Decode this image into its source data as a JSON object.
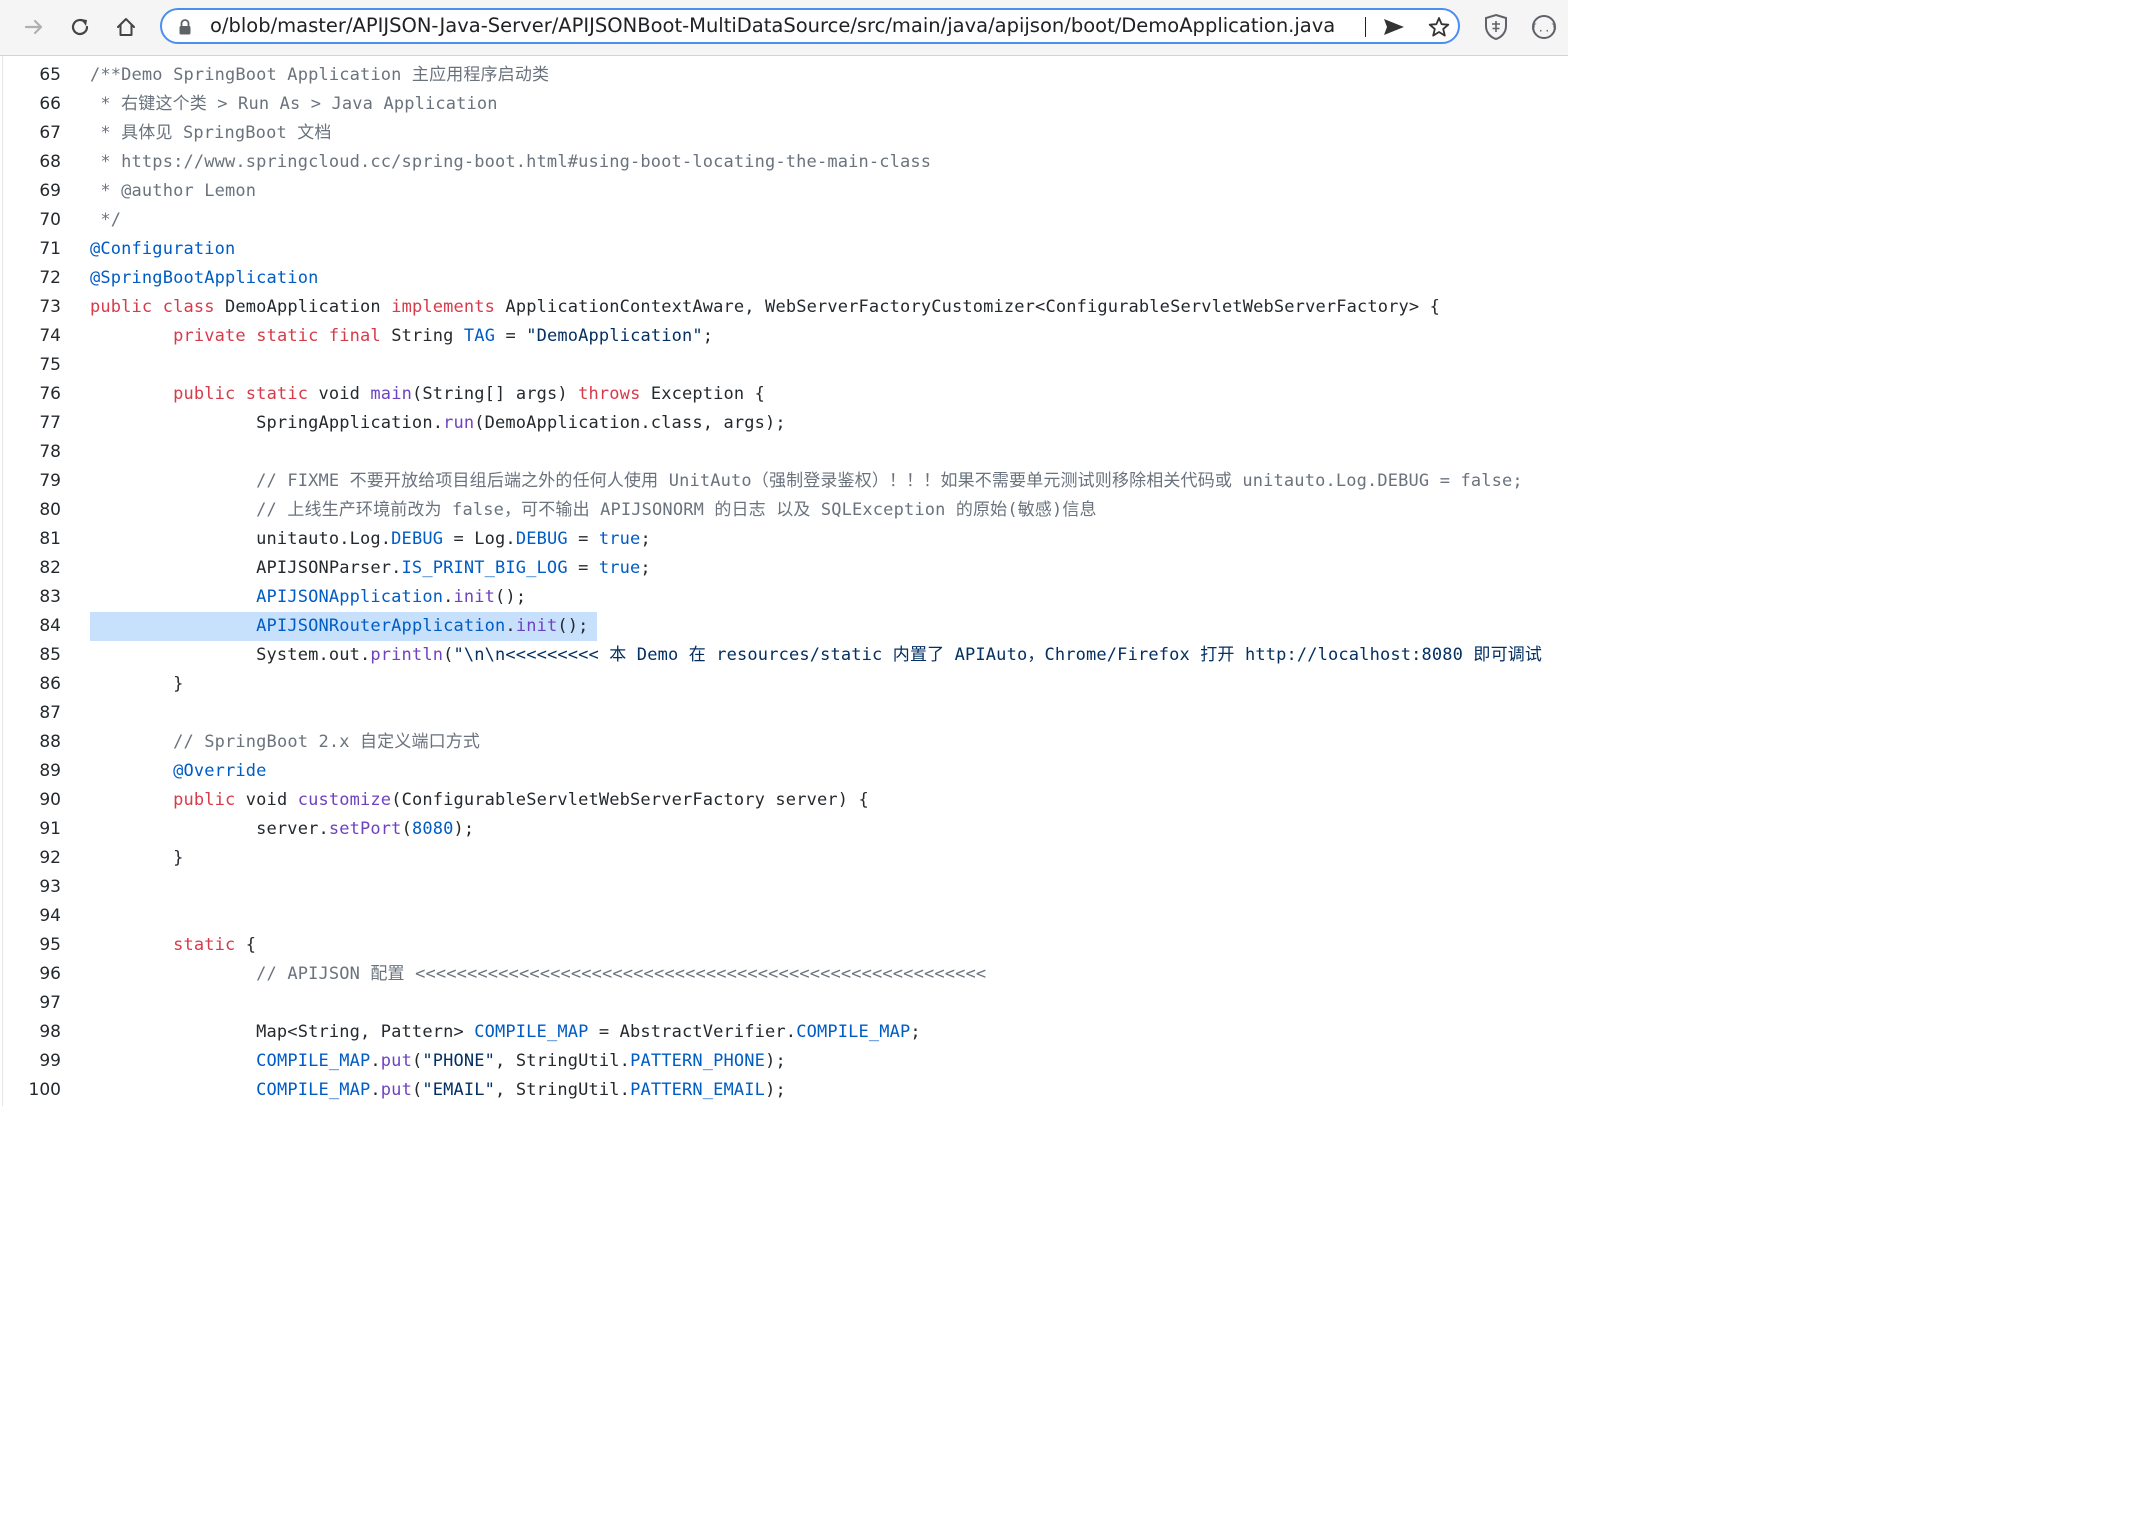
{
  "browser": {
    "url": "o/blob/master/APIJSON-Java-Server/APIJSONBoot-MultiDataSource/src/main/java/apijson/boot/DemoApplication.java",
    "icons": [
      "forward-icon",
      "reload-icon",
      "home-icon",
      "lock-icon",
      "send-icon",
      "star-icon",
      "extension-shield-icon",
      "extension-braces-icon"
    ]
  },
  "colors": {
    "keyword": "#d73a49",
    "function": "#6f42c1",
    "constant": "#005cc5",
    "string": "#032f62",
    "comment": "#6a737d",
    "highlight": "#c7e0fb",
    "omnibox_border": "#4b8ef1"
  },
  "code": {
    "highlighted_line": "84",
    "lines": [
      {
        "n": "65",
        "t": [
          [
            "c",
            "/**Demo SpringBoot Application 主应用程序启动类"
          ]
        ]
      },
      {
        "n": "66",
        "t": [
          [
            "c",
            " * 右键这个类 > Run As > Java Application"
          ]
        ]
      },
      {
        "n": "67",
        "t": [
          [
            "c",
            " * 具体见 SpringBoot 文档"
          ]
        ]
      },
      {
        "n": "68",
        "t": [
          [
            "c",
            " * https://www.springcloud.cc/spring-boot.html#using-boot-locating-the-main-class"
          ]
        ]
      },
      {
        "n": "69",
        "t": [
          [
            "c",
            " * @author Lemon"
          ]
        ]
      },
      {
        "n": "70",
        "t": [
          [
            "c",
            " */"
          ]
        ]
      },
      {
        "n": "71",
        "t": [
          [
            "b",
            "@Configuration"
          ]
        ]
      },
      {
        "n": "72",
        "t": [
          [
            "b",
            "@SpringBootApplication"
          ]
        ]
      },
      {
        "n": "73",
        "t": [
          [
            "k",
            "public"
          ],
          [
            "",
            " "
          ],
          [
            "k",
            "class"
          ],
          [
            "",
            " DemoApplication "
          ],
          [
            "k",
            "implements"
          ],
          [
            "",
            " ApplicationContextAware, WebServerFactoryCustomizer<ConfigurableServletWebServerFactory> {"
          ]
        ]
      },
      {
        "n": "74",
        "t": [
          [
            "",
            "        "
          ],
          [
            "k",
            "private"
          ],
          [
            "",
            " "
          ],
          [
            "k",
            "static"
          ],
          [
            "",
            " "
          ],
          [
            "k",
            "final"
          ],
          [
            "",
            " String "
          ],
          [
            "b",
            "TAG"
          ],
          [
            "",
            " = "
          ],
          [
            "s",
            "\"DemoApplication\""
          ],
          [
            "",
            ";"
          ]
        ]
      },
      {
        "n": "75",
        "t": []
      },
      {
        "n": "76",
        "t": [
          [
            "",
            "        "
          ],
          [
            "k",
            "public"
          ],
          [
            "",
            " "
          ],
          [
            "k",
            "static"
          ],
          [
            "",
            " void "
          ],
          [
            "f",
            "main"
          ],
          [
            "",
            "(String[] args) "
          ],
          [
            "k",
            "throws"
          ],
          [
            "",
            " Exception {"
          ]
        ]
      },
      {
        "n": "77",
        "t": [
          [
            "",
            "                SpringApplication."
          ],
          [
            "f",
            "run"
          ],
          [
            "",
            "(DemoApplication.class, args);"
          ]
        ]
      },
      {
        "n": "78",
        "t": []
      },
      {
        "n": "79",
        "t": [
          [
            "",
            "                "
          ],
          [
            "c",
            "// FIXME 不要开放给项目组后端之外的任何人使用 UnitAuto（强制登录鉴权）！！！如果不需要单元测试则移除相关代码或 unitauto.Log.DEBUG = false;"
          ]
        ]
      },
      {
        "n": "80",
        "t": [
          [
            "",
            "                "
          ],
          [
            "c",
            "// 上线生产环境前改为 false，可不输出 APIJSONORM 的日志 以及 SQLException 的原始(敏感)信息"
          ]
        ]
      },
      {
        "n": "81",
        "t": [
          [
            "",
            "                unitauto.Log."
          ],
          [
            "b",
            "DEBUG"
          ],
          [
            "",
            " = Log."
          ],
          [
            "b",
            "DEBUG"
          ],
          [
            "",
            " = "
          ],
          [
            "b",
            "true"
          ],
          [
            "",
            ";"
          ]
        ]
      },
      {
        "n": "82",
        "t": [
          [
            "",
            "                APIJSONParser."
          ],
          [
            "b",
            "IS_PRINT_BIG_LOG"
          ],
          [
            "",
            " = "
          ],
          [
            "b",
            "true"
          ],
          [
            "",
            ";"
          ]
        ]
      },
      {
        "n": "83",
        "t": [
          [
            "",
            "                "
          ],
          [
            "b",
            "APIJSONApplication"
          ],
          [
            "",
            "."
          ],
          [
            "f",
            "init"
          ],
          [
            "",
            "();"
          ]
        ]
      },
      {
        "n": "84",
        "t": [
          [
            "",
            "                "
          ],
          [
            "b",
            "APIJSONRouterApplication"
          ],
          [
            "",
            "."
          ],
          [
            "f",
            "init"
          ],
          [
            "",
            "();"
          ]
        ]
      },
      {
        "n": "85",
        "t": [
          [
            "",
            "                System.out."
          ],
          [
            "f",
            "println"
          ],
          [
            "",
            "("
          ],
          [
            "s",
            "\"\\n\\n<<<<<<<<< 本 Demo 在 resources/static 内置了 APIAuto，Chrome/Firefox 打开 http://localhost:8080 即可调试"
          ]
        ]
      },
      {
        "n": "86",
        "t": [
          [
            "",
            "        }"
          ]
        ]
      },
      {
        "n": "87",
        "t": []
      },
      {
        "n": "88",
        "t": [
          [
            "",
            "        "
          ],
          [
            "c",
            "// SpringBoot 2.x 自定义端口方式"
          ]
        ]
      },
      {
        "n": "89",
        "t": [
          [
            "",
            "        "
          ],
          [
            "b",
            "@Override"
          ]
        ]
      },
      {
        "n": "90",
        "t": [
          [
            "",
            "        "
          ],
          [
            "k",
            "public"
          ],
          [
            "",
            " void "
          ],
          [
            "f",
            "customize"
          ],
          [
            "",
            "(ConfigurableServletWebServerFactory server) {"
          ]
        ]
      },
      {
        "n": "91",
        "t": [
          [
            "",
            "                server."
          ],
          [
            "f",
            "setPort"
          ],
          [
            "",
            "("
          ],
          [
            "b",
            "8080"
          ],
          [
            "",
            ");"
          ]
        ]
      },
      {
        "n": "92",
        "t": [
          [
            "",
            "        }"
          ]
        ]
      },
      {
        "n": "93",
        "t": []
      },
      {
        "n": "94",
        "t": []
      },
      {
        "n": "95",
        "t": [
          [
            "",
            "        "
          ],
          [
            "k",
            "static"
          ],
          [
            "",
            " {"
          ]
        ]
      },
      {
        "n": "96",
        "t": [
          [
            "",
            "                "
          ],
          [
            "c",
            "// APIJSON 配置 <<<<<<<<<<<<<<<<<<<<<<<<<<<<<<<<<<<<<<<<<<<<<<<<<<<<<<<"
          ]
        ]
      },
      {
        "n": "97",
        "t": []
      },
      {
        "n": "98",
        "t": [
          [
            "",
            "                Map<String, Pattern> "
          ],
          [
            "b",
            "COMPILE_MAP"
          ],
          [
            "",
            " = AbstractVerifier."
          ],
          [
            "b",
            "COMPILE_MAP"
          ],
          [
            "",
            ";"
          ]
        ]
      },
      {
        "n": "99",
        "t": [
          [
            "",
            "                "
          ],
          [
            "b",
            "COMPILE_MAP"
          ],
          [
            "",
            "."
          ],
          [
            "f",
            "put"
          ],
          [
            "",
            "("
          ],
          [
            "s",
            "\"PHONE\""
          ],
          [
            "",
            ", StringUtil."
          ],
          [
            "b",
            "PATTERN_PHONE"
          ],
          [
            "",
            ");"
          ]
        ]
      },
      {
        "n": "100",
        "t": [
          [
            "",
            "                "
          ],
          [
            "b",
            "COMPILE_MAP"
          ],
          [
            "",
            "."
          ],
          [
            "f",
            "put"
          ],
          [
            "",
            "("
          ],
          [
            "s",
            "\"EMAIL\""
          ],
          [
            "",
            ", StringUtil."
          ],
          [
            "b",
            "PATTERN_EMAIL"
          ],
          [
            "",
            ");"
          ]
        ]
      }
    ]
  }
}
